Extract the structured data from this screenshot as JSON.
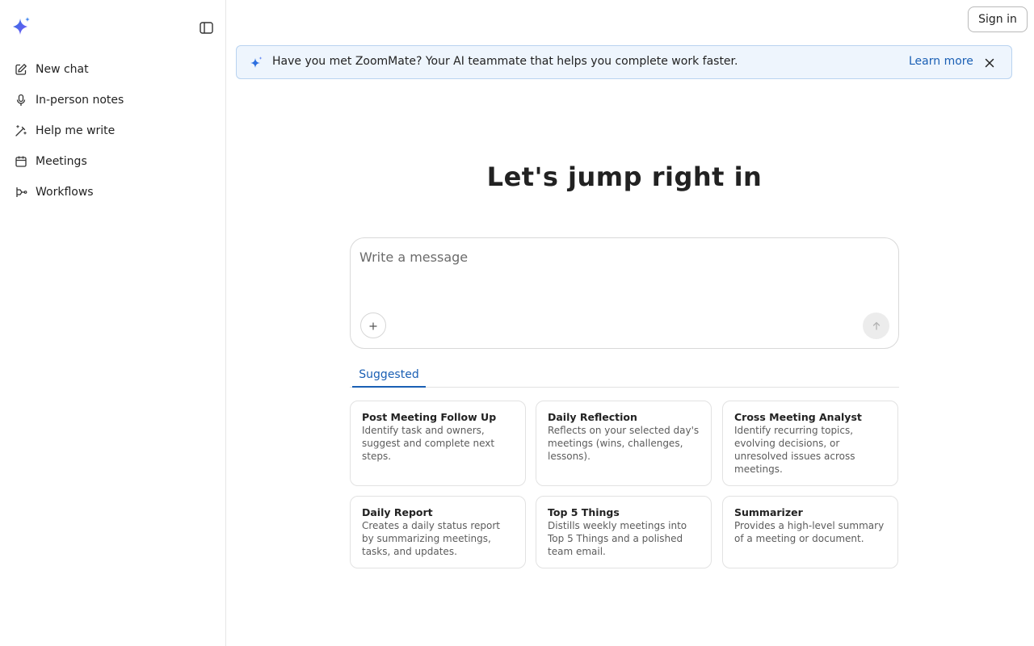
{
  "sidebar": {
    "items": [
      {
        "label": "New chat",
        "icon": "edit-icon"
      },
      {
        "label": "In-person notes",
        "icon": "microphone-icon"
      },
      {
        "label": "Help me write",
        "icon": "magic-wand-icon"
      },
      {
        "label": "Meetings",
        "icon": "calendar-icon"
      },
      {
        "label": "Workflows",
        "icon": "workflow-icon"
      }
    ]
  },
  "header": {
    "signin_label": "Sign in"
  },
  "banner": {
    "text": "Have you met ZoomMate? Your AI teammate that helps you complete work faster.",
    "link_label": "Learn more"
  },
  "main": {
    "heading": "Let's jump right in",
    "composer": {
      "placeholder": "Write a message",
      "value": ""
    },
    "tabs": [
      {
        "label": "Suggested",
        "active": true
      }
    ],
    "cards": [
      {
        "title": "Post Meeting Follow Up",
        "desc": "Identify task and owners, suggest and complete next steps."
      },
      {
        "title": "Daily Reflection",
        "desc": "Reflects on your selected day's meetings (wins, challenges, lessons)."
      },
      {
        "title": "Cross Meeting Analyst",
        "desc": "Identify recurring topics, evolving decisions, or unresolved issues across meetings."
      },
      {
        "title": "Daily Report",
        "desc": "Creates a daily status report by summarizing meetings, tasks, and updates."
      },
      {
        "title": "Top 5 Things",
        "desc": "Distills weekly meetings into Top 5 Things and a polished team email."
      },
      {
        "title": "Summarizer",
        "desc": "Provides a high-level summary of a meeting or document."
      }
    ]
  },
  "colors": {
    "accent": "#1a5fb4",
    "banner_bg": "#eef5fd",
    "banner_border": "#b9d3f0",
    "logo_gradient_start": "#2d6fe0",
    "logo_gradient_end": "#7a5af8"
  }
}
